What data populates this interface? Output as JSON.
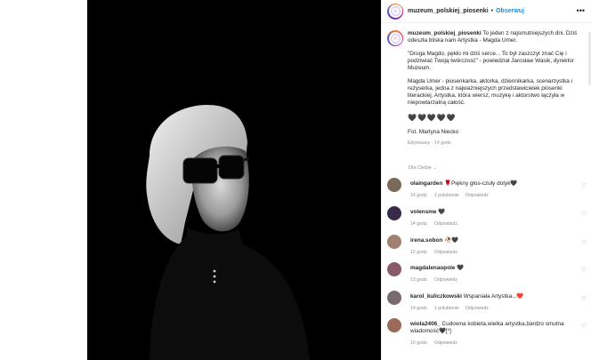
{
  "post": {
    "username": "muzeum_polskiej_piosenki",
    "follow_label": "Obserwuj",
    "more_icon": "more-horizontal-icon"
  },
  "caption": {
    "text_1": "To jeden z najsmutniejszych dni. Dziś odeszła bliska nam Artystka - Magda Umer.",
    "text_2": "\"Droga Magdo, pękło mi dziś serce... To był zaszczyt znać Cię i podziwiać Twoją twórczość\" - powiedział Jarosław Wasik, dyrektor Muzeum.",
    "text_3": "Magda Umer - piosenkarka, aktorka, dziennikarka, scenarzystka i reżyserka, jedna z najważniejszych przedstawicielek piosenki literackiej. Artystka, która wiersz, muzykę i aktorstwo łączyła w niepowtarzalną całość.",
    "hearts": "🖤🖤🖤🖤🖤",
    "photo_credit": "Fot. Martyna Niecko",
    "edited": "Edytowany · 14 godz."
  },
  "for_you_label": "Dla Ciebie",
  "comments": [
    {
      "user": "olaingarden",
      "text": "🌹Piękny głos-czuły dotyk🖤",
      "time": "14 godz.",
      "likes": "1 polubienie",
      "reply": "Odpowiedz",
      "avatar_color": "#7a6a5a"
    },
    {
      "user": "volensme",
      "text": "🖤",
      "time": "14 godz.",
      "likes": "",
      "reply": "Odpowiedz",
      "avatar_color": "#3a2a4a"
    },
    {
      "user": "irena.sobon",
      "text": "🥀🖤",
      "time": "12 godz.",
      "likes": "",
      "reply": "Odpowiedz",
      "avatar_color": "#a08070"
    },
    {
      "user": "magdalenaopole",
      "text": "🖤",
      "time": "13 godz.",
      "likes": "",
      "reply": "Odpowiedz",
      "avatar_color": "#8a5a6a"
    },
    {
      "user": "karol_kuliczkowski",
      "text": "Wspaniała Artystka...❤️",
      "time": "14 godz.",
      "likes": "1 polubienie",
      "reply": "Odpowiedz",
      "avatar_color": "#7a6a70"
    },
    {
      "user": "wiola2406_",
      "text": "Cudowna kobieta,wielka artystka,bardzo smutna wiadomość🖤[*]",
      "time": "10 godz.",
      "likes": "",
      "reply": "Odpowiedz",
      "avatar_color": "#9a6a5a"
    }
  ]
}
